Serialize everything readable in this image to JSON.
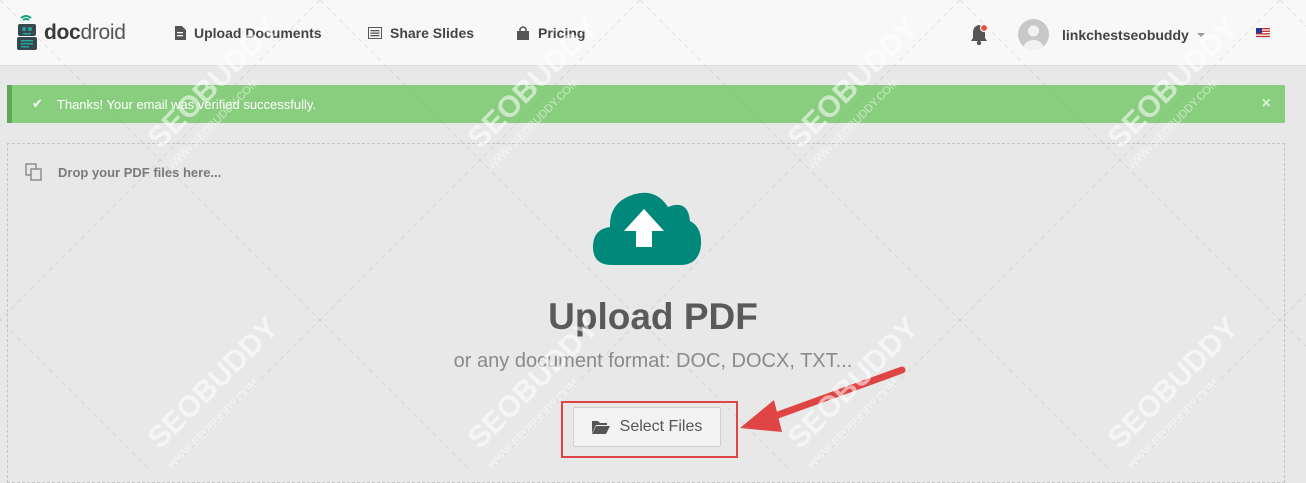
{
  "brand": {
    "bold": "doc",
    "light": "droid"
  },
  "nav": {
    "items": [
      {
        "label": "Upload Documents",
        "icon": "document-icon"
      },
      {
        "label": "Share Slides",
        "icon": "slides-icon"
      },
      {
        "label": "Pricing",
        "icon": "shopping-bag-icon"
      }
    ],
    "username": "linkchestseobuddy"
  },
  "alert": {
    "message": "Thanks! Your email was verified successfully.",
    "close": "×",
    "check": "✔"
  },
  "dropzone": {
    "hint": "Drop your PDF files here...",
    "title": "Upload PDF",
    "subtitle": "or any document format: DOC, DOCX, TXT...",
    "button": "Select Files"
  },
  "watermark": {
    "brand": "SEOBUDDY",
    "url": "WWW.SEOBUDDY.COM"
  },
  "colors": {
    "accent": "#00897b",
    "alert": "#89ce7f",
    "highlight": "#e04545"
  }
}
